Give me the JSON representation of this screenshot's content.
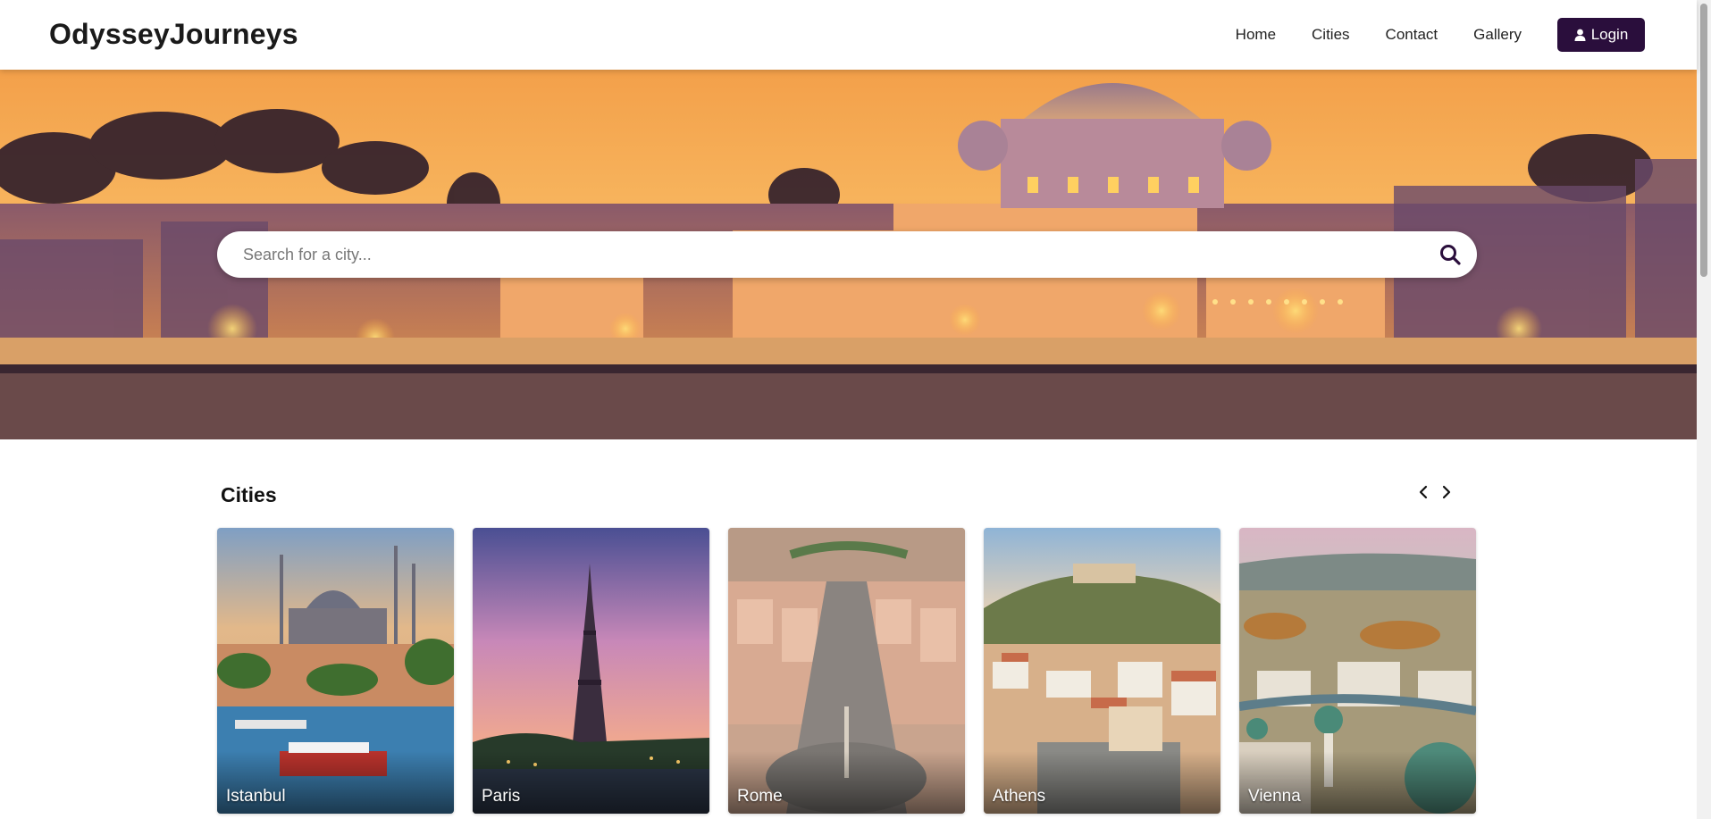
{
  "header": {
    "brand": "OdysseyJourneys",
    "nav": [
      {
        "label": "Home"
      },
      {
        "label": "Cities"
      },
      {
        "label": "Contact"
      },
      {
        "label": "Gallery"
      }
    ],
    "login_label": "Login",
    "login_icon": "user-icon"
  },
  "hero": {
    "search_placeholder": "Search for a city...",
    "search_icon": "search-icon"
  },
  "cities": {
    "title": "Cities",
    "prev_icon": "chevron-left-icon",
    "next_icon": "chevron-right-icon",
    "items": [
      {
        "name": "Istanbul"
      },
      {
        "name": "Paris"
      },
      {
        "name": "Rome"
      },
      {
        "name": "Athens"
      },
      {
        "name": "Vienna"
      }
    ]
  },
  "colors": {
    "brand_dark": "#2a0e3c",
    "sky_orange": "#f39a3c"
  }
}
